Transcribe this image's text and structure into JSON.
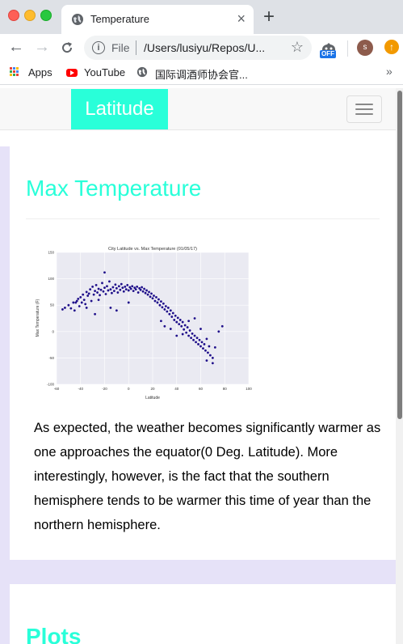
{
  "browser": {
    "tab_title": "Temperature",
    "url_scheme_label": "File",
    "url": "/Users/lusiyu/Repos/U...",
    "extension_badge": "OFF",
    "profile_initial": "s",
    "bookmarks": [
      {
        "label": "Apps",
        "icon": "apps-grid-icon"
      },
      {
        "label": "YouTube",
        "icon": "youtube-icon"
      },
      {
        "label": "国际调酒师协会官...",
        "icon": "globe-icon"
      }
    ],
    "more_bookmarks": "»"
  },
  "site": {
    "brand": "Latitude",
    "accent_color": "#29ffd9",
    "band_color": "#e6e2f8"
  },
  "section": {
    "title": "Max Temperature",
    "description": "As expected, the weather becomes significantly warmer as one approaches the equator(0 Deg. Latitude). More interestingly, however, is the fact that the southern hemisphere tends to be warmer this time of year than the northern hemisphere."
  },
  "next_section": {
    "title": "Plots"
  },
  "chart_data": {
    "type": "scatter",
    "title": "City Latitude vs. Max Temperature (01/05/17)",
    "xlabel": "Latitude",
    "ylabel": "Max Temperature (F)",
    "xlim": [
      -60,
      100
    ],
    "ylim": [
      -100,
      150
    ],
    "xticks": [
      -60,
      -40,
      -20,
      0,
      20,
      40,
      60,
      80,
      100
    ],
    "yticks": [
      -100,
      -50,
      0,
      50,
      100,
      150
    ],
    "grid": true,
    "marker_color": "#1f0f8a",
    "background_color": "#eaeaf2",
    "series": [
      {
        "points": [
          [
            -55,
            42
          ],
          [
            -53,
            45
          ],
          [
            -50,
            50
          ],
          [
            -48,
            44
          ],
          [
            -46,
            55
          ],
          [
            -45,
            40
          ],
          [
            -43,
            58
          ],
          [
            -42,
            62
          ],
          [
            -41,
            48
          ],
          [
            -40,
            65
          ],
          [
            -39,
            55
          ],
          [
            -38,
            70
          ],
          [
            -37,
            60
          ],
          [
            -36,
            52
          ],
          [
            -35,
            75
          ],
          [
            -34,
            68
          ],
          [
            -33,
            72
          ],
          [
            -32,
            80
          ],
          [
            -31,
            58
          ],
          [
            -30,
            85
          ],
          [
            -29,
            70
          ],
          [
            -28,
            77
          ],
          [
            -28,
            33
          ],
          [
            -27,
            88
          ],
          [
            -26,
            74
          ],
          [
            -25,
            81
          ],
          [
            -24,
            69
          ],
          [
            -23,
            79
          ],
          [
            -22,
            92
          ],
          [
            -21,
            76
          ],
          [
            -20,
            83
          ],
          [
            -20,
            112
          ],
          [
            -19,
            71
          ],
          [
            -18,
            86
          ],
          [
            -17,
            78
          ],
          [
            -16,
            95
          ],
          [
            -15,
            80
          ],
          [
            -15,
            45
          ],
          [
            -14,
            73
          ],
          [
            -13,
            84
          ],
          [
            -12,
            77
          ],
          [
            -11,
            89
          ],
          [
            -10,
            82
          ],
          [
            -10,
            40
          ],
          [
            -9,
            74
          ],
          [
            -8,
            86
          ],
          [
            -7,
            79
          ],
          [
            -6,
            90
          ],
          [
            -5,
            83
          ],
          [
            -4,
            76
          ],
          [
            -3,
            85
          ],
          [
            -2,
            80
          ],
          [
            -1,
            88
          ],
          [
            0,
            78
          ],
          [
            0,
            55
          ],
          [
            1,
            84
          ],
          [
            2,
            81
          ],
          [
            3,
            86
          ],
          [
            4,
            77
          ],
          [
            5,
            83
          ],
          [
            6,
            80
          ],
          [
            7,
            85
          ],
          [
            8,
            74
          ],
          [
            9,
            82
          ],
          [
            10,
            79
          ],
          [
            11,
            84
          ],
          [
            12,
            76
          ],
          [
            13,
            81
          ],
          [
            14,
            73
          ],
          [
            15,
            78
          ],
          [
            16,
            70
          ],
          [
            17,
            75
          ],
          [
            18,
            66
          ],
          [
            19,
            72
          ],
          [
            20,
            63
          ],
          [
            21,
            68
          ],
          [
            22,
            58
          ],
          [
            23,
            65
          ],
          [
            24,
            55
          ],
          [
            25,
            61
          ],
          [
            26,
            50
          ],
          [
            27,
            57
          ],
          [
            27,
            20
          ],
          [
            28,
            46
          ],
          [
            29,
            53
          ],
          [
            30,
            42
          ],
          [
            30,
            10
          ],
          [
            31,
            48
          ],
          [
            32,
            38
          ],
          [
            33,
            45
          ],
          [
            34,
            33
          ],
          [
            35,
            40
          ],
          [
            35,
            5
          ],
          [
            36,
            28
          ],
          [
            37,
            35
          ],
          [
            38,
            22
          ],
          [
            39,
            30
          ],
          [
            40,
            18
          ],
          [
            40,
            -8
          ],
          [
            41,
            26
          ],
          [
            42,
            14
          ],
          [
            43,
            22
          ],
          [
            44,
            10
          ],
          [
            45,
            18
          ],
          [
            46,
            4
          ],
          [
            47,
            12
          ],
          [
            48,
            -2
          ],
          [
            49,
            8
          ],
          [
            50,
            -8
          ],
          [
            50,
            20
          ],
          [
            51,
            2
          ],
          [
            52,
            -12
          ],
          [
            53,
            -4
          ],
          [
            54,
            -16
          ],
          [
            55,
            -8
          ],
          [
            55,
            25
          ],
          [
            56,
            -20
          ],
          [
            57,
            -12
          ],
          [
            58,
            -24
          ],
          [
            59,
            -16
          ],
          [
            60,
            -28
          ],
          [
            60,
            5
          ],
          [
            61,
            -20
          ],
          [
            62,
            -32
          ],
          [
            63,
            -24
          ],
          [
            64,
            -36
          ],
          [
            65,
            -14
          ],
          [
            66,
            -40
          ],
          [
            67,
            -28
          ],
          [
            68,
            -45
          ],
          [
            70,
            -50
          ],
          [
            72,
            -30
          ],
          [
            75,
            0
          ],
          [
            78,
            10
          ],
          [
            70,
            -60
          ],
          [
            65,
            -55
          ],
          [
            45,
            -5
          ],
          [
            -44,
            55
          ],
          [
            -35,
            45
          ],
          [
            -25,
            60
          ]
        ]
      }
    ]
  }
}
